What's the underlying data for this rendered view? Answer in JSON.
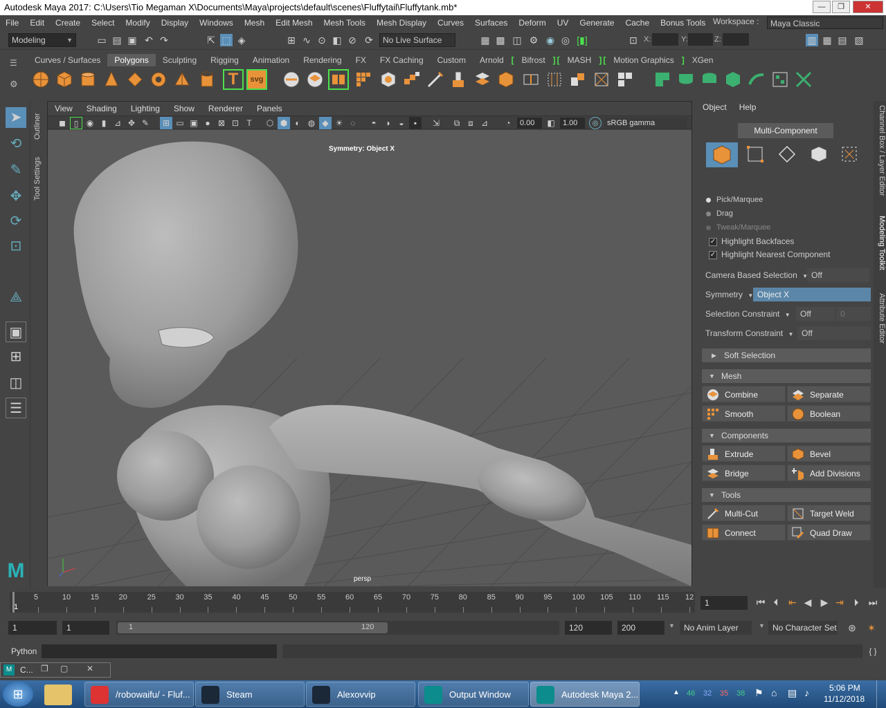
{
  "window": {
    "title": "Autodesk Maya 2017: C:\\Users\\Tio Megaman X\\Documents\\Maya\\projects\\default\\scenes\\Fluffytail\\Fluffytank.mb*",
    "controls": [
      "—",
      "❐",
      "✕"
    ]
  },
  "menubar": [
    "File",
    "Edit",
    "Create",
    "Select",
    "Modify",
    "Display",
    "Windows",
    "Mesh",
    "Edit Mesh",
    "Mesh Tools",
    "Mesh Display",
    "Curves",
    "Surfaces",
    "Deform",
    "UV",
    "Generate",
    "Cache",
    "Bonus Tools"
  ],
  "statusline": {
    "mode": "Modeling",
    "live_surface": "No Live Surface",
    "workspace_label": "Workspace :",
    "workspace_value": "Maya Classic",
    "x_label": "X:",
    "y_label": "Y:",
    "z_label": "Z:"
  },
  "shelf_tabs": [
    {
      "label": "Curves / Surfaces",
      "active": false
    },
    {
      "label": "Polygons",
      "active": true
    },
    {
      "label": "Sculpting",
      "active": false
    },
    {
      "label": "Rigging",
      "active": false
    },
    {
      "label": "Animation",
      "active": false
    },
    {
      "label": "Rendering",
      "active": false
    },
    {
      "label": "FX",
      "active": false
    },
    {
      "label": "FX Caching",
      "active": false
    },
    {
      "label": "Custom",
      "active": false
    },
    {
      "label": "Arnold",
      "active": false
    },
    {
      "label": "Bifrost",
      "active": false
    },
    {
      "label": "MASH",
      "active": false
    },
    {
      "label": "Motion Graphics",
      "active": false
    },
    {
      "label": "XGen",
      "active": false
    }
  ],
  "shelf_icon_text": {
    "text_tool": "T",
    "svg_tool": "svg"
  },
  "left_side_tabs": {
    "outliner": "Outliner",
    "tool_settings": "Tool Settings"
  },
  "viewport": {
    "menu": [
      "View",
      "Shading",
      "Lighting",
      "Show",
      "Renderer",
      "Panels"
    ],
    "field_a": "0.00",
    "field_b": "1.00",
    "color_space": "sRGB gamma",
    "symmetry_hud": "Symmetry: Object X",
    "camera": "persp"
  },
  "modeling_toolkit": {
    "menu": [
      "Object",
      "Help"
    ],
    "multi_component": "Multi-Component",
    "pick_marquee": "Pick/Marquee",
    "drag": "Drag",
    "tweak_marquee": "Tweak/Marquee",
    "highlight_backfaces": "Highlight Backfaces",
    "highlight_nearest": "Highlight Nearest Component",
    "check": "✓",
    "camera_based_selection_label": "Camera Based Selection",
    "camera_based_selection_value": "Off",
    "symmetry_label": "Symmetry",
    "symmetry_value": "Object X",
    "selection_constraint_label": "Selection Constraint",
    "selection_constraint_value": "Off",
    "selection_constraint_num": "0",
    "transform_constraint_label": "Transform Constraint",
    "transform_constraint_value": "Off",
    "soft_selection": "Soft Selection",
    "mesh_header": "Mesh",
    "mesh_buttons": [
      "Combine",
      "Separate",
      "Smooth",
      "Boolean"
    ],
    "components_header": "Components",
    "components_buttons": [
      "Extrude",
      "Bevel",
      "Bridge",
      "Add Divisions"
    ],
    "tools_header": "Tools",
    "tools_buttons": [
      "Multi-Cut",
      "Target Weld",
      "Connect",
      "Quad Draw"
    ]
  },
  "right_side_tabs": {
    "channel_box": "Channel Box / Layer Editor",
    "modeling_toolkit": "Modeling Toolkit",
    "attribute_editor": "Attribute Editor"
  },
  "timeline": {
    "ticks": [
      "1",
      "5",
      "10",
      "15",
      "20",
      "25",
      "30",
      "35",
      "40",
      "45",
      "50",
      "55",
      "60",
      "65",
      "70",
      "75",
      "80",
      "85",
      "90",
      "95",
      "100",
      "105",
      "110",
      "115",
      "12"
    ],
    "current_frame": "1"
  },
  "range": {
    "start": "1",
    "playback_start": "1",
    "slider_start": "1",
    "slider_end": "120",
    "playback_end": "120",
    "end": "200",
    "anim_layer": "No Anim Layer",
    "character_set": "No Character Set"
  },
  "command_line": {
    "language": "Python"
  },
  "mini_window": {
    "label": "C..."
  },
  "taskbar": {
    "items": [
      {
        "label": "/robowaifu/ - Fluf...",
        "color": "#d33"
      },
      {
        "label": "Steam",
        "color": "#1b2838"
      },
      {
        "label": "Alexovvip",
        "color": "#1b2838"
      },
      {
        "label": "Output Window",
        "color": "#0c8c8c"
      },
      {
        "label": "Autodesk Maya 2...",
        "color": "#0c8c8c"
      }
    ],
    "tray_nums": [
      "46",
      "32",
      "35",
      "38"
    ],
    "time": "5:06 PM",
    "date": "11/12/2018"
  },
  "colors": {
    "accent": "#5a9fd4",
    "shelf_orange": "#e8923a",
    "bracket_green": "#4ce04c",
    "symmetry_blue": "#5b86a8"
  }
}
